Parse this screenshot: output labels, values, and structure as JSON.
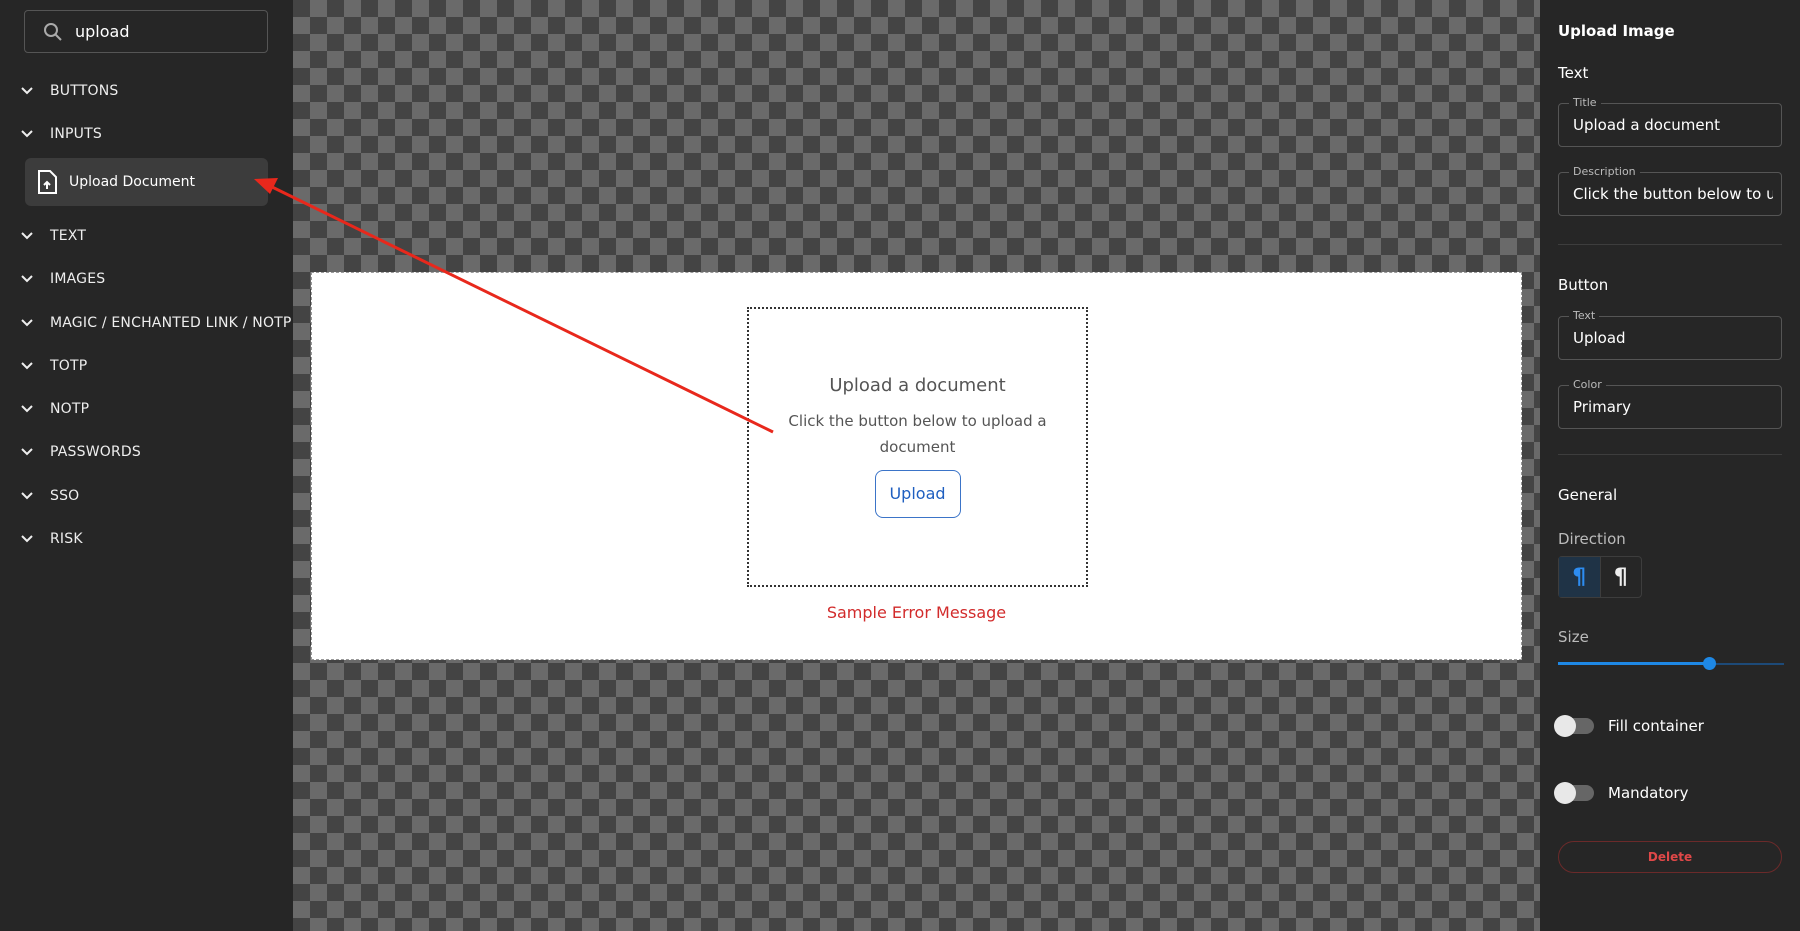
{
  "sidebar": {
    "search": {
      "value": "upload",
      "icon": "search-icon"
    },
    "categories": [
      {
        "label": "BUTTONS"
      },
      {
        "label": "INPUTS"
      },
      {
        "label": "TEXT"
      },
      {
        "label": "IMAGES"
      },
      {
        "label": "MAGIC / ENCHANTED LINK / NOTP"
      },
      {
        "label": "TOTP"
      },
      {
        "label": "NOTP"
      },
      {
        "label": "PASSWORDS"
      },
      {
        "label": "SSO"
      },
      {
        "label": "RISK"
      }
    ],
    "selected_item": {
      "label": "Upload Document",
      "icon": "file-upload-icon"
    }
  },
  "canvas": {
    "title": "Upload a document",
    "description": "Click the button below to upload a document",
    "button": "Upload",
    "error": "Sample Error Message",
    "annotation_color": "#e8281c"
  },
  "panel": {
    "heading": "Upload Image",
    "text_section": "Text",
    "title_label": "Title",
    "title_value": "Upload a document",
    "description_label": "Description",
    "description_value": "Click the button below to upload a document",
    "button_section": "Button",
    "button_text_label": "Text",
    "button_text_value": "Upload",
    "color_label": "Color",
    "color_value": "Primary",
    "general_section": "General",
    "direction_label": "Direction",
    "direction_options": [
      "ltr",
      "rtl"
    ],
    "direction_selected": "ltr",
    "size_label": "Size",
    "size_value": 2,
    "size_max": 3,
    "fill_container_label": "Fill container",
    "fill_container": false,
    "mandatory_label": "Mandatory",
    "mandatory": false,
    "delete_label": "Delete",
    "accent": "#1e88e5",
    "danger": "#e04848"
  }
}
